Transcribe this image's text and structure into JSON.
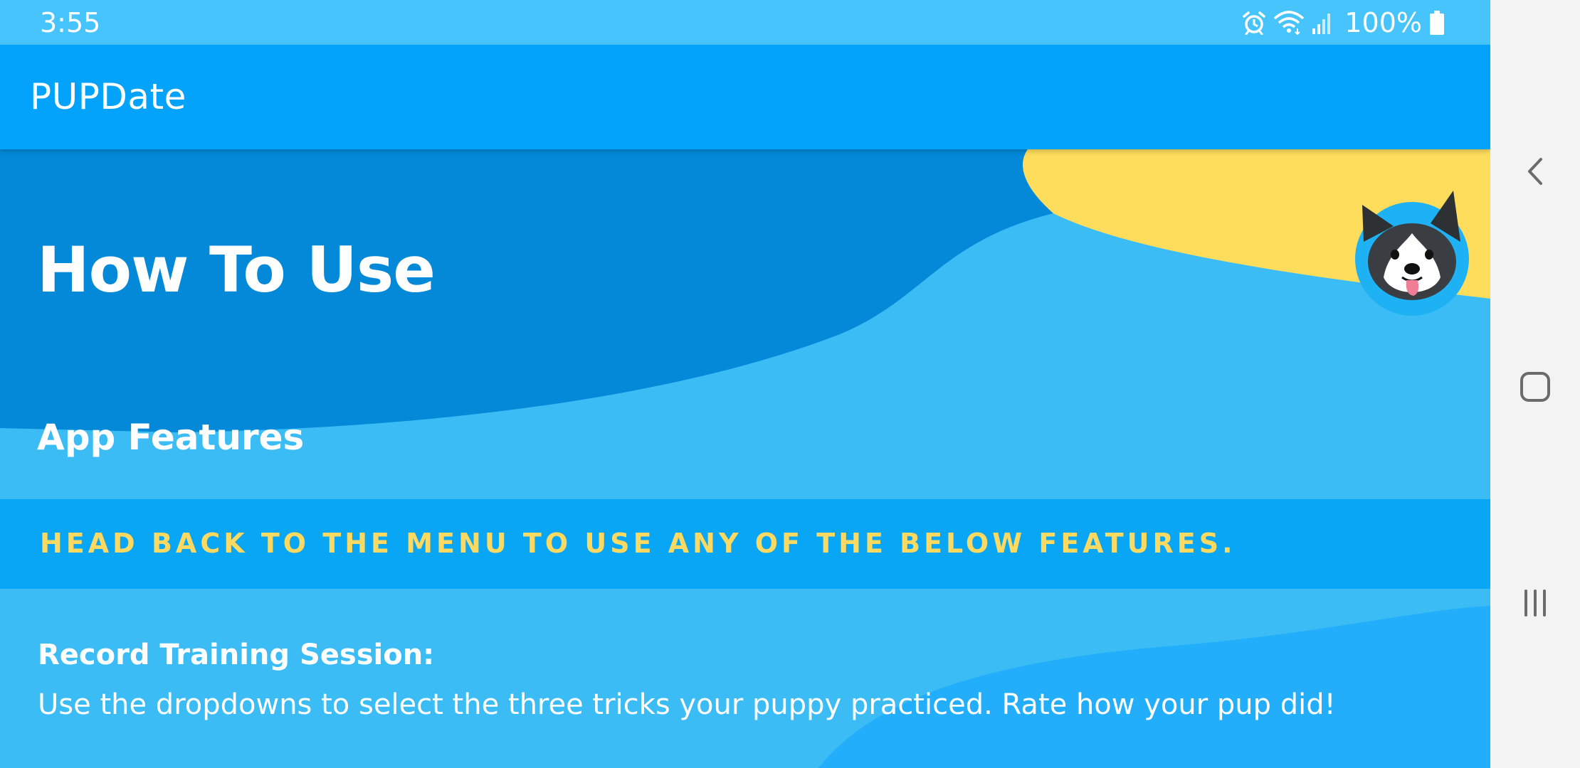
{
  "status_bar": {
    "time": "3:55",
    "battery": "100%",
    "icons": [
      "alarm-icon",
      "wifi-icon",
      "signal-icon",
      "battery-icon"
    ]
  },
  "app_bar": {
    "title": "PUPDate"
  },
  "hero": {
    "title": "How To Use",
    "section_title": "App Features",
    "logo": "dog-face-logo"
  },
  "banner": {
    "text": "HEAD BACK TO THE MENU TO USE ANY OF THE BELOW FEATURES."
  },
  "features": [
    {
      "title": "Record Training Session:",
      "description": "Use the dropdowns to select the three tricks your puppy practiced. Rate how your pup did!"
    }
  ],
  "system_nav": {
    "buttons": [
      "back-icon",
      "home-icon",
      "recents-icon"
    ]
  },
  "colors": {
    "status_bar": "#46c4fb",
    "app_bar": "#03a2fb",
    "hero_dark": "#0389d8",
    "background": "#3bbcf5",
    "accent_yellow": "#fedc5c",
    "banner": "#0aa6f6",
    "banner_text": "#fcd960",
    "nav_bar": "#f3f3f3"
  }
}
